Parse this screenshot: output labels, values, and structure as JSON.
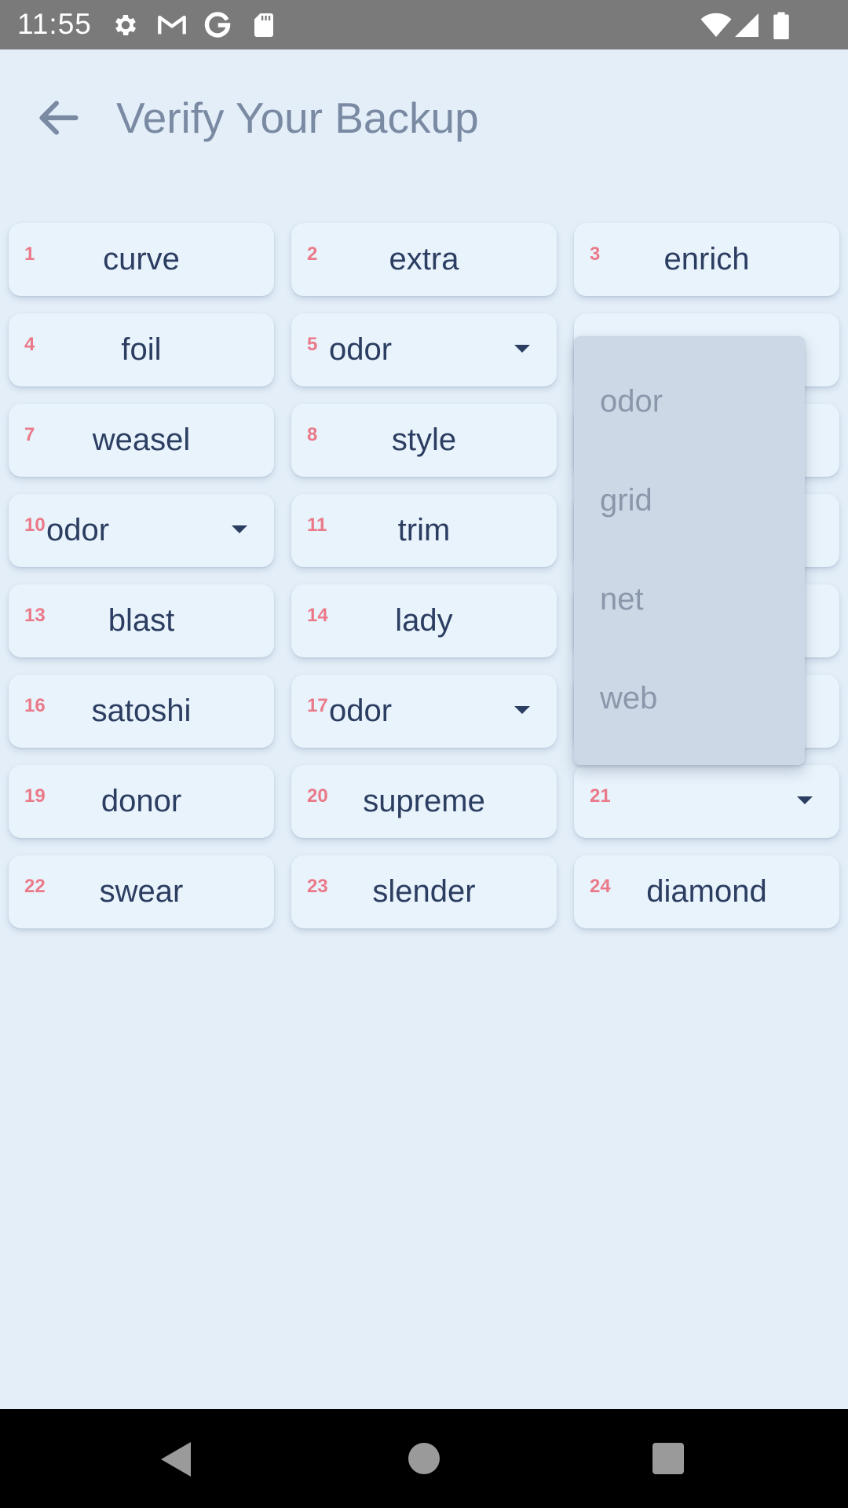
{
  "status_bar": {
    "time": "11:55",
    "icons": [
      "gear-icon",
      "gmail-icon",
      "google-icon",
      "sd-card-icon",
      "wifi-icon",
      "cell-signal-icon",
      "battery-icon"
    ]
  },
  "app_bar": {
    "title": "Verify Your Backup",
    "back_icon": "arrow-left-icon"
  },
  "words": [
    {
      "index": "1",
      "word": "curve",
      "type": "text"
    },
    {
      "index": "2",
      "word": "extra",
      "type": "text"
    },
    {
      "index": "3",
      "word": "enrich",
      "type": "text"
    },
    {
      "index": "4",
      "word": "foil",
      "type": "text"
    },
    {
      "index": "5",
      "word": "odor",
      "type": "dropdown"
    },
    {
      "index": "",
      "word": "",
      "type": "hidden"
    },
    {
      "index": "7",
      "word": "weasel",
      "type": "text"
    },
    {
      "index": "8",
      "word": "style",
      "type": "text"
    },
    {
      "index": "",
      "word": "",
      "type": "hidden"
    },
    {
      "index": "10",
      "word": "odor",
      "type": "dropdown"
    },
    {
      "index": "11",
      "word": "trim",
      "type": "text"
    },
    {
      "index": "",
      "word": "",
      "type": "hidden"
    },
    {
      "index": "13",
      "word": "blast",
      "type": "text"
    },
    {
      "index": "14",
      "word": "lady",
      "type": "text"
    },
    {
      "index": "",
      "word": "",
      "type": "hidden"
    },
    {
      "index": "16",
      "word": "satoshi",
      "type": "text"
    },
    {
      "index": "17",
      "word": "odor",
      "type": "dropdown"
    },
    {
      "index": "",
      "word": "",
      "type": "hidden"
    },
    {
      "index": "19",
      "word": "donor",
      "type": "text"
    },
    {
      "index": "20",
      "word": "supreme",
      "type": "text"
    },
    {
      "index": "21",
      "word": "",
      "type": "dropdown"
    },
    {
      "index": "22",
      "word": "swear",
      "type": "text"
    },
    {
      "index": "23",
      "word": "slender",
      "type": "text"
    },
    {
      "index": "24",
      "word": "diamond",
      "type": "text"
    }
  ],
  "dropdown_menu": {
    "options": [
      "odor",
      "grid",
      "net",
      "web"
    ]
  },
  "colors": {
    "background": "#e3eef8",
    "card": "#e9f3fb",
    "index": "#ea7a8a",
    "word": "#2b3d61",
    "title": "#7a8aa3",
    "menu": "#cdd8e6"
  },
  "nav_bar": {
    "icons": [
      "nav-back-icon",
      "nav-home-icon",
      "nav-recents-icon"
    ]
  }
}
